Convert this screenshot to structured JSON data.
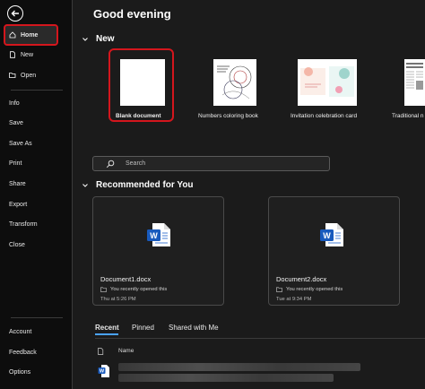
{
  "sidebar": {
    "home": "Home",
    "new": "New",
    "open": "Open",
    "items": [
      "Info",
      "Save",
      "Save As",
      "Print",
      "Share",
      "Export",
      "Transform",
      "Close"
    ],
    "bottom": [
      "Account",
      "Feedback",
      "Options"
    ]
  },
  "main": {
    "greeting": "Good evening",
    "new_section": "New",
    "templates": [
      {
        "label": "Blank document",
        "icon": "blank-doc"
      },
      {
        "label": "Numbers coloring book",
        "icon": "coloring-book"
      },
      {
        "label": "Invitation celebration card",
        "icon": "invitation-card"
      },
      {
        "label": "Traditional n",
        "icon": "newspaper"
      }
    ],
    "search_placeholder": "Search",
    "recommended_section": "Recommended for You",
    "docs": [
      {
        "name": "Document1.docx",
        "sub": "You recently opened this",
        "time": "Thu at 5:26 PM"
      },
      {
        "name": "Document2.docx",
        "sub": "You recently opened this",
        "time": "Tue at 9:34 PM"
      }
    ],
    "tabs": [
      "Recent",
      "Pinned",
      "Shared with Me"
    ],
    "list_header": "Name"
  },
  "colors": {
    "accent_red": "#d4161d",
    "word_blue": "#185abd",
    "tab_underline": "#4aa3ff"
  }
}
